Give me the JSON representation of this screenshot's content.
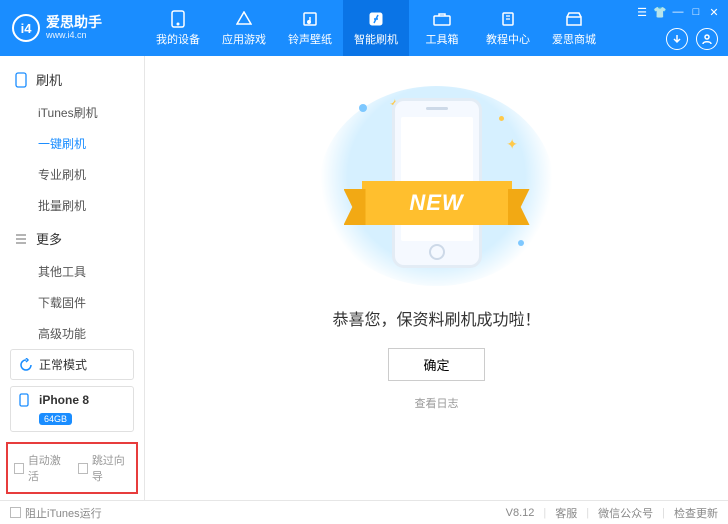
{
  "brand": {
    "name": "爱思助手",
    "url": "www.i4.cn",
    "logo_text": "i4"
  },
  "nav": [
    {
      "label": "我的设备",
      "icon": "phone"
    },
    {
      "label": "应用游戏",
      "icon": "app"
    },
    {
      "label": "铃声壁纸",
      "icon": "note"
    },
    {
      "label": "智能刷机",
      "icon": "flash",
      "active": true
    },
    {
      "label": "工具箱",
      "icon": "toolbox"
    },
    {
      "label": "教程中心",
      "icon": "book"
    },
    {
      "label": "爱思商城",
      "icon": "store"
    }
  ],
  "sidebar": {
    "group1": {
      "title": "刷机",
      "items": [
        "iTunes刷机",
        "一键刷机",
        "专业刷机",
        "批量刷机"
      ],
      "activeIndex": 1
    },
    "group2": {
      "title": "更多",
      "items": [
        "其他工具",
        "下载固件",
        "高级功能"
      ]
    },
    "mode": {
      "label": "正常模式"
    },
    "device": {
      "name": "iPhone 8",
      "storage": "64GB"
    },
    "checks": {
      "auto_activate": "自动激活",
      "skip_guide": "跳过向导"
    }
  },
  "main": {
    "ribbon": "NEW",
    "success": "恭喜您，保资料刷机成功啦！",
    "ok": "确定",
    "view_log": "查看日志"
  },
  "statusbar": {
    "block_itunes": "阻止iTunes运行",
    "version": "V8.12",
    "support": "客服",
    "wechat": "微信公众号",
    "update": "检查更新"
  }
}
